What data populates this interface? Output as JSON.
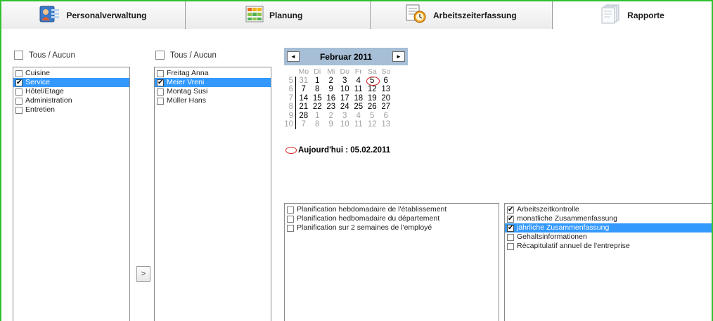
{
  "tabs": [
    {
      "label": "Personalverwaltung",
      "icon": "personnel-icon"
    },
    {
      "label": "Planung",
      "icon": "planning-grid-icon"
    },
    {
      "label": "Arbeitszeiterfassung",
      "icon": "clock-document-icon"
    },
    {
      "label": "Rapporte",
      "icon": "reports-icon"
    }
  ],
  "departments": {
    "select_all_label": "Tous / Aucun",
    "items": [
      {
        "label": "Cuisine",
        "checked": false,
        "selected": false
      },
      {
        "label": "Service",
        "checked": true,
        "selected": true
      },
      {
        "label": "Hôtel/Etage",
        "checked": false,
        "selected": false
      },
      {
        "label": "Administration",
        "checked": false,
        "selected": false
      },
      {
        "label": "Entretien",
        "checked": false,
        "selected": false
      }
    ]
  },
  "employees": {
    "select_all_label": "Tous / Aucun",
    "items": [
      {
        "label": "Freitag Anna",
        "checked": false,
        "selected": false
      },
      {
        "label": "Meier Vreni",
        "checked": true,
        "selected": true
      },
      {
        "label": "Montag Susi",
        "checked": false,
        "selected": false
      },
      {
        "label": "Müller Hans",
        "checked": false,
        "selected": false
      }
    ]
  },
  "move_button_label": ">",
  "calendar": {
    "prev_label": "◄",
    "next_label": "►",
    "title": "Februar 2011",
    "weekdays": [
      "Mo",
      "Di",
      "Mi",
      "Do",
      "Fr",
      "Sa",
      "So"
    ],
    "weeks": [
      {
        "wk": "5",
        "days": [
          "31",
          "1",
          "2",
          "3",
          "4",
          "5",
          "6"
        ]
      },
      {
        "wk": "6",
        "days": [
          "7",
          "8",
          "9",
          "10",
          "11",
          "12",
          "13"
        ]
      },
      {
        "wk": "7",
        "days": [
          "14",
          "15",
          "16",
          "17",
          "18",
          "19",
          "20"
        ]
      },
      {
        "wk": "8",
        "days": [
          "21",
          "22",
          "23",
          "24",
          "25",
          "26",
          "27"
        ]
      },
      {
        "wk": "9",
        "days": [
          "28",
          "1",
          "2",
          "3",
          "4",
          "5",
          "6"
        ]
      },
      {
        "wk": "10",
        "days": [
          "7",
          "8",
          "9",
          "10",
          "11",
          "12",
          "13"
        ]
      }
    ],
    "today_label": "Aujourd'hui : 05.02.2011"
  },
  "planning_reports": {
    "items": [
      {
        "label": "Planification hebdomadaire de l'établissement",
        "checked": false,
        "selected": false
      },
      {
        "label": "Planification hedbomadaire du département",
        "checked": false,
        "selected": false
      },
      {
        "label": "Planification sur 2 semaines de l'employé",
        "checked": false,
        "selected": false
      }
    ]
  },
  "time_reports": {
    "items": [
      {
        "label": "Arbeitszeitkontrolle",
        "checked": true,
        "selected": false
      },
      {
        "label": "monatliche Zusammenfassung",
        "checked": true,
        "selected": false
      },
      {
        "label": "jährliche Zusammenfassung",
        "checked": true,
        "selected": true
      },
      {
        "label": "Gehaltsinformationen",
        "checked": false,
        "selected": false
      },
      {
        "label": "Récapitulatif annuel de l'entreprise",
        "checked": false,
        "selected": false
      }
    ]
  },
  "colors": {
    "frame": "#2fc22f",
    "selection": "#3399ff",
    "calendar_header": "#a7bfd6",
    "today_ring": "#d31d1d"
  }
}
